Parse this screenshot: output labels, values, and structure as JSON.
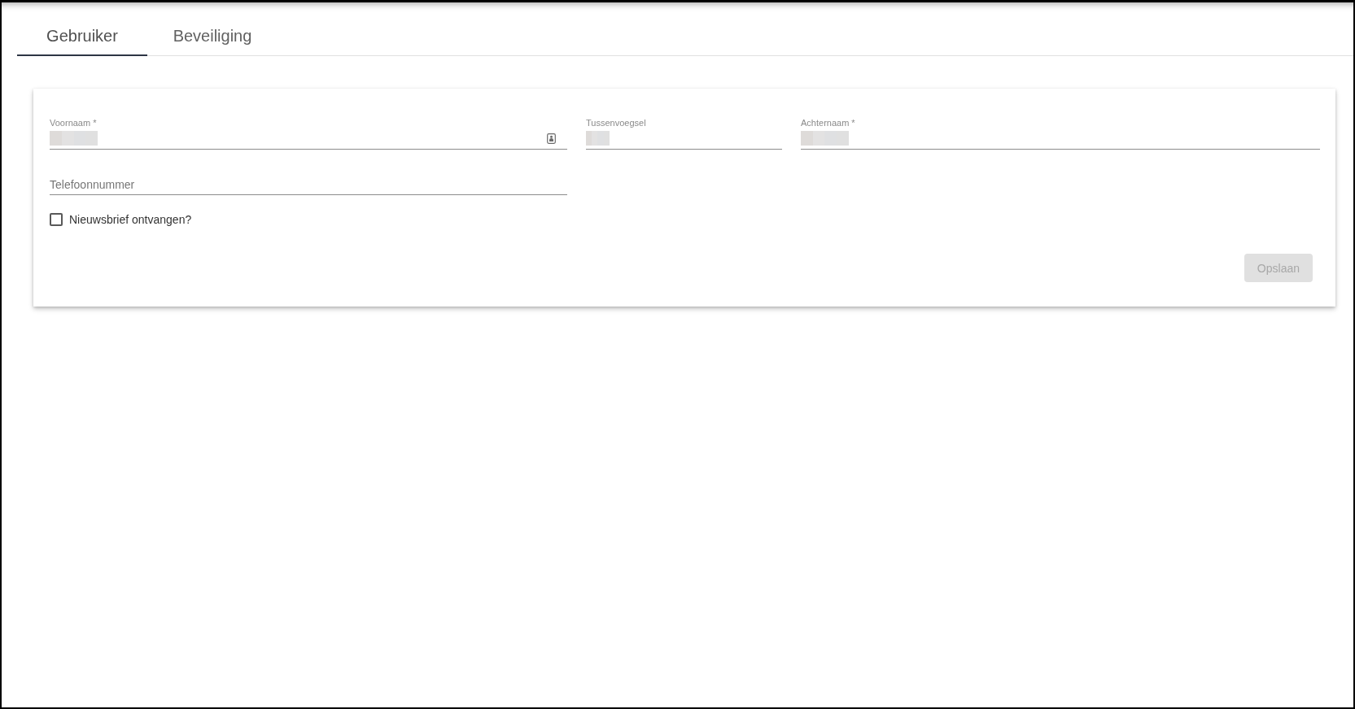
{
  "tabs": [
    {
      "label": "Gebruiker",
      "selected": true
    },
    {
      "label": "Beveiliging",
      "selected": false
    }
  ],
  "form": {
    "fields": [
      {
        "label": "Voornaam *",
        "redacted": true,
        "autofill_icon": true
      },
      {
        "label": "Tussenvoegsel",
        "redacted": true,
        "autofill_icon": false
      },
      {
        "label": "Achternaam *",
        "redacted": true,
        "autofill_icon": false
      }
    ],
    "phone": {
      "placeholder": "Telefoonnummer"
    },
    "newsletter": {
      "label": "Nieuwsbrief ontvangen?",
      "checked": false
    },
    "save_button": {
      "label": "Opslaan",
      "disabled": true
    }
  }
}
